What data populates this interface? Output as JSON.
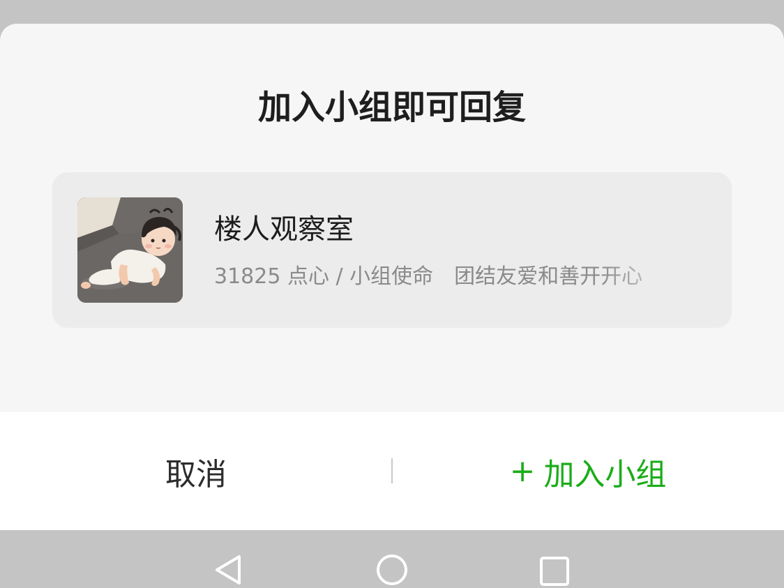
{
  "dialog": {
    "title": "加入小组即可回复"
  },
  "group": {
    "name": "楼人观察室",
    "members_label": "31825 点心 / 小组使命",
    "mission": "团结友爱和善开开心"
  },
  "actions": {
    "cancel_label": "取消",
    "join_plus": "+",
    "join_label": "加入小组"
  },
  "colors": {
    "accent_green": "#1aad19",
    "sheet_bg": "#f6f6f6",
    "card_bg": "#ececec",
    "scrim": "#c4c4c4"
  },
  "icons": {
    "nav_back": "back-triangle-icon",
    "nav_home": "home-circle-icon",
    "nav_recent": "recent-apps-square-icon"
  }
}
